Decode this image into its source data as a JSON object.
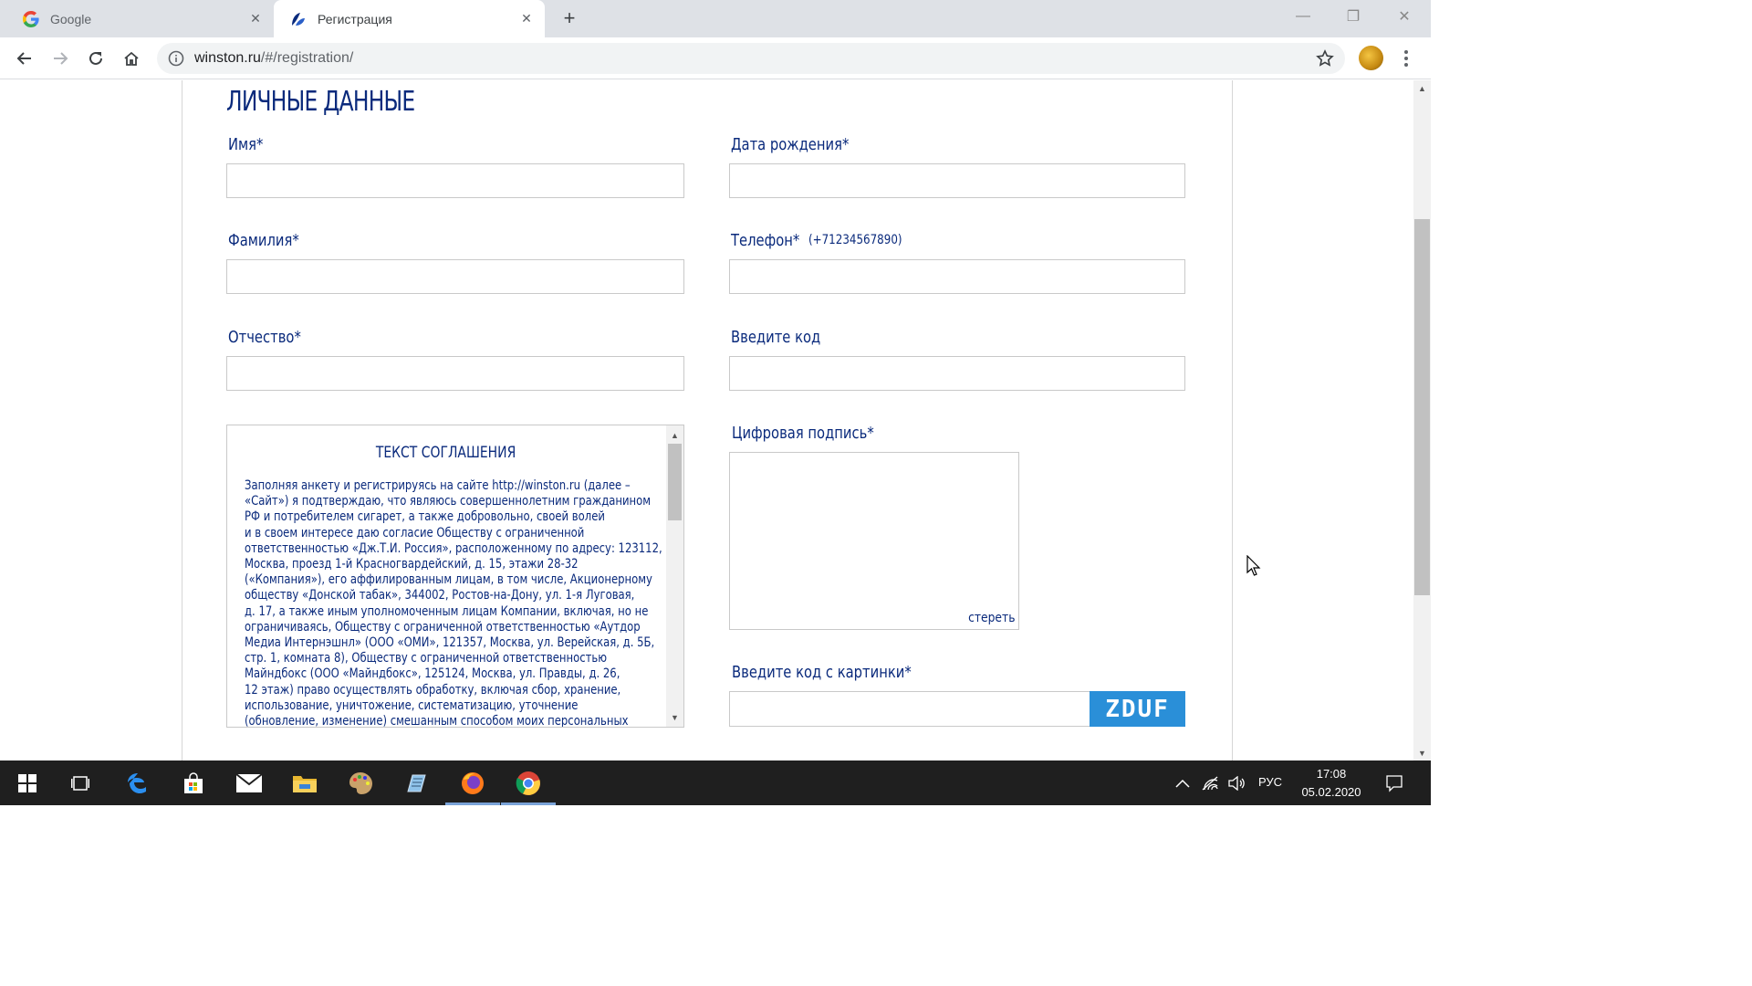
{
  "browser": {
    "tabs": [
      {
        "title": "Google",
        "active": false
      },
      {
        "title": "Регистрация",
        "active": true
      }
    ],
    "url_host": "winston.ru",
    "url_path": "/#/registration/"
  },
  "form": {
    "section_title": "ЛИЧНЫЕ ДАННЫЕ",
    "first_name_label": "Имя*",
    "last_name_label": "Фамилия*",
    "patronymic_label": "Отчество*",
    "birth_date_label": "Дата рождения*",
    "phone_label": "Телефон*",
    "phone_hint": "(+71234567890)",
    "code_label": "Введите код",
    "signature_label": "Цифровая подпись*",
    "clear_signature": "стереть",
    "captcha_label": "Введите код с картинки*",
    "captcha_text": "ZDUF",
    "first_name_value": "",
    "last_name_value": "",
    "patronymic_value": "",
    "birth_date_value": "",
    "phone_value": "",
    "code_value": "",
    "captcha_value": ""
  },
  "agreement": {
    "title": "ТЕКСТ СОГЛАШЕНИЯ",
    "lines": [
      "Заполняя анкету и регистрируясь на сайте http://winston.ru (далее –",
      "«Сайт») я подтверждаю, что являюсь совершеннолетним гражданином",
      "РФ и потребителем сигарет, а также добровольно, своей волей",
      "и в своем интересе даю согласие Обществу с ограниченной",
      "ответственностью «Дж.Т.И. Россия», расположенному по адресу: 123112,",
      "Москва, проезд 1-й Красногвардейский, д. 15, этажи 28-32",
      "(«Компания»), его аффилированным лицам, в том числе, Акционерному",
      "обществу «Донской табак», 344002, Ростов-на-Дону, ул. 1-я Луговая,",
      "д. 17, а также иным уполномоченным лицам Компании, включая, но не",
      "ограничиваясь, Обществу с ограниченной ответственностью «Аутдор",
      "Медиа Интернэшнл» (ООО «ОМИ», 121357, Москва, ул. Верейская, д. 5Б,",
      "стр. 1, комната 8), Обществу с ограниченной ответственностью",
      "Майндбокс (ООО «Майндбокс», 125124, Москва, ул. Правды, д. 26,",
      "12 этаж) право осуществлять обработку, включая сбор, хранение,",
      "использование, уничтожение, систематизацию, уточнение",
      "(обновление, изменение) смешанным способом моих персональных"
    ]
  },
  "taskbar": {
    "language": "РУС",
    "time": "17:08",
    "date": "05.02.2020"
  },
  "colors": {
    "brand_navy": "#0a2a7c",
    "captcha_bg": "#2a8fd8",
    "input_border": "#c9c9c9"
  }
}
